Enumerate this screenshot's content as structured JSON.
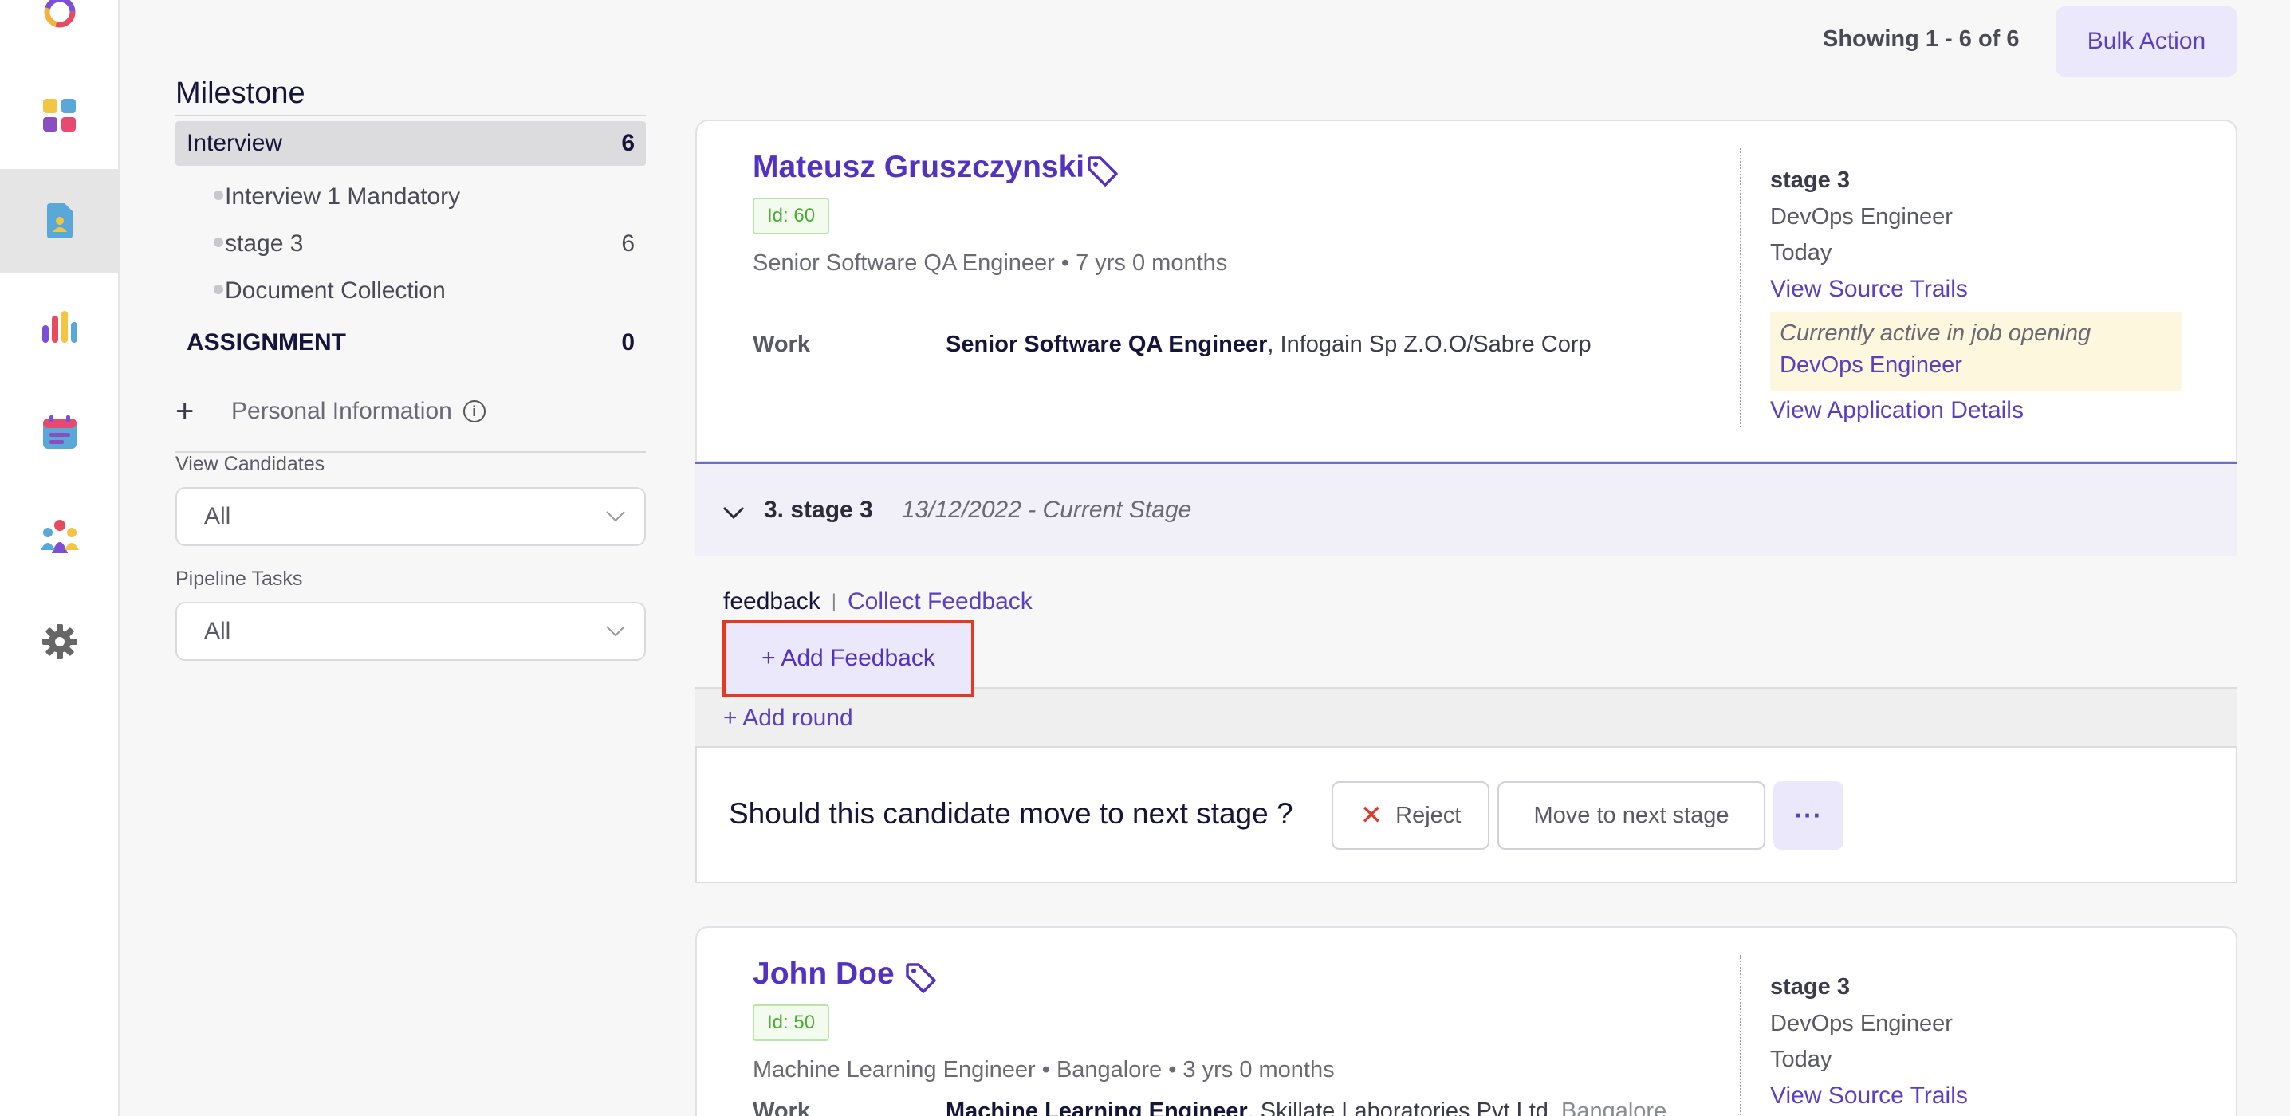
{
  "rail": {
    "items": [
      "logo-icon",
      "dashboard-icon",
      "candidates-icon",
      "reports-icon",
      "calendar-icon",
      "team-icon",
      "settings-icon"
    ],
    "active": "candidates-icon",
    "colors": {
      "active_bg": "#e5e5e5"
    }
  },
  "filters": {
    "milestone_title": "Milestone",
    "milestones": [
      {
        "label": "Interview",
        "count": "6",
        "active": true,
        "stages": [
          {
            "label": "Interview 1 Mandatory",
            "count": ""
          },
          {
            "label": "stage 3",
            "count": "6"
          },
          {
            "label": "Document Collection",
            "count": ""
          }
        ]
      },
      {
        "label": "ASSIGNMENT",
        "count": "0",
        "active": false
      }
    ],
    "personal_info": {
      "plus": "+",
      "label": "Personal Information",
      "info": "i"
    },
    "view_candidates": {
      "label": "View Candidates",
      "value": "All"
    },
    "pipeline_tasks": {
      "label": "Pipeline Tasks",
      "value": "All"
    }
  },
  "topbar": {
    "showing": "Showing 1 - 6 of 6",
    "bulk_action": "Bulk Action"
  },
  "candidates": [
    {
      "name": "Mateusz Gruszczynski",
      "id_label": "Id: 60",
      "subtitle": "Senior Software QA Engineer • 7 yrs 0 months",
      "work_label": "Work",
      "work_title": "Senior Software QA Engineer",
      "work_company": ", Infogain Sp Z.O.O/Sabre Corp",
      "stage": "stage 3",
      "job": "DevOps Engineer",
      "when": "Today",
      "source_trails": "View Source Trails",
      "active_note": "Currently active in job opening",
      "active_job": "DevOps Engineer",
      "application_details": "View Application Details"
    },
    {
      "name": "John Doe",
      "id_label": "Id: 50",
      "subtitle": "Machine Learning Engineer • Bangalore • 3 yrs 0 months",
      "work_label": "Work",
      "work_title": "Machine Learning Engineer",
      "work_company": ", Skillate Laboratories Pvt Ltd",
      "work_location": ", Bangalore",
      "stage": "stage 3",
      "job": "DevOps Engineer",
      "when": "Today",
      "source_trails": "View Source Trails"
    }
  ],
  "stage_panel": {
    "chevron": "⌄",
    "stage_name": "3. stage 3",
    "stage_date": "13/12/2022 - Current Stage",
    "feedback_label": "feedback",
    "separator": "|",
    "collect_feedback": "Collect Feedback",
    "add_feedback": "+ Add Feedback",
    "add_round": "+ Add round",
    "question": "Should this candidate move to next stage ?",
    "reject": "Reject",
    "reject_icon": "✕",
    "move_next": "Move to next stage",
    "more": "···"
  },
  "colors": {
    "accent": "#5a3fc0",
    "highlight_border": "#e53a1f",
    "badge_green": "#4bab35",
    "reject_red": "#e13a2a"
  }
}
